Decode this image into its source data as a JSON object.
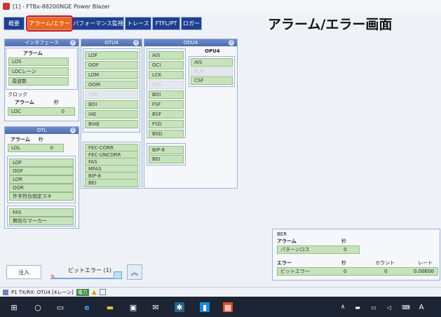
{
  "window": {
    "title": "[1] - FTBx-88200NGE Power Blazer"
  },
  "overlay_title": "アラーム/エラー画面",
  "tabs": [
    {
      "label": "概要"
    },
    {
      "label": "アラーム/エラー"
    },
    {
      "label": "パフォーマンス監視"
    },
    {
      "label": "トレース"
    },
    {
      "label": "FTFL/PT"
    },
    {
      "label": "ロガー"
    }
  ],
  "interface_panel": {
    "title": "インタフェース",
    "alarm_header": "アラーム",
    "items": [
      "LOS",
      "LOCレーン",
      "周波数"
    ],
    "clock_label": "クロック",
    "clock_alarm_header": "アラーム",
    "clock_sec_header": "秒",
    "clock_item": "LOC",
    "clock_value": "0"
  },
  "otl_panel": {
    "title": "OTL",
    "alarm_header": "アラーム",
    "sec_header": "秒",
    "lol_item": "LOL",
    "lol_value": "0",
    "items": [
      "LOF",
      "OOF",
      "LOR",
      "OOR",
      "外字符合指定スキ"
    ],
    "items2": [
      "FAS",
      "無効なマーカー"
    ]
  },
  "otu4_panel": {
    "title": "OTU4",
    "items": [
      "LOF",
      "OOF",
      "LOM",
      "OOM",
      "TIM",
      "BDI",
      "IAE",
      "BIAE"
    ],
    "errors": [
      "FEC-CORR",
      "FEC-UNCORR",
      "FAS",
      "MFAS",
      "BIP-8",
      "BEI"
    ]
  },
  "odu4_panel": {
    "title": "ODU4",
    "items": [
      "AIS",
      "OCI",
      "LCK",
      "TIM",
      "BDI",
      "FSF",
      "BSF",
      "FSD",
      "BSD"
    ],
    "errors": [
      "BIP-8",
      "BEI"
    ],
    "opu4_header": "OPU4",
    "opu4_items": [
      "AIS",
      "PLM",
      "CSF"
    ]
  },
  "ber_panel": {
    "title": "BER",
    "alarm_header": "アラーム",
    "sec_header": "秒",
    "pattern_loss": "パターンロス",
    "pattern_loss_value": "0",
    "error_header": "エラー",
    "error_sec_header": "秒",
    "count_header": "カウント",
    "rate_header": "レート",
    "bit_error": "ビットエラー",
    "bit_error_sec": "0",
    "bit_error_count": "0",
    "bit_error_rate": "0.00E00"
  },
  "inject": {
    "button_label": "注入",
    "bit_error_label": "ビットエラー (1)"
  },
  "status": {
    "text": "P1 TX/RX: OTU4 [4レーン]",
    "power_label": "電力"
  },
  "colors": {
    "tab_bg": "#1f3f8f",
    "tab_active": "#e96a1d",
    "alarm_green": "#c8e2bd",
    "highlight_red": "#e01010"
  }
}
